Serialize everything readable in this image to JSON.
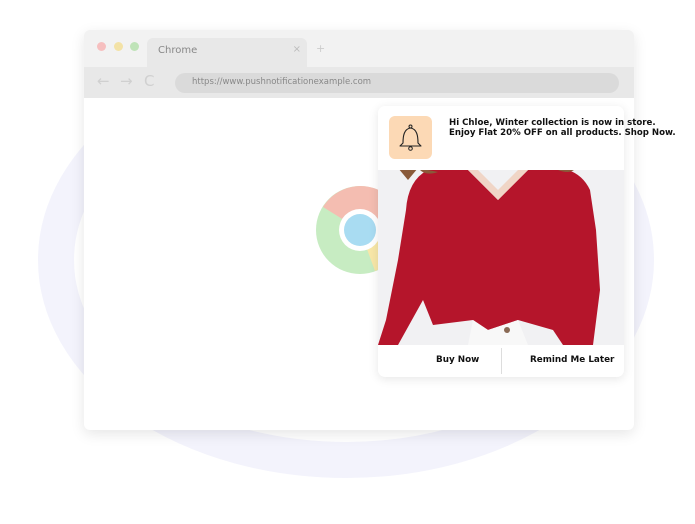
{
  "browser": {
    "tab_label": "Chrome",
    "tab_close_icon": "×",
    "new_tab_icon": "+",
    "back_icon": "←",
    "forward_icon": "→",
    "reload_icon": "C",
    "url": "https://www.pushnotificationexample.com"
  },
  "notification": {
    "message": "Hi Chloe, Winter collection is now in store. Enjoy Flat 20% OFF on all products. Shop Now.",
    "icon": "bell-icon",
    "buttons": {
      "buy_now": "Buy Now",
      "remind_later": "Remind Me Later"
    }
  },
  "colors": {
    "bell_bg": "#fcd9b5",
    "sweater": "#b5152b",
    "ring": "#f3f3fc"
  }
}
